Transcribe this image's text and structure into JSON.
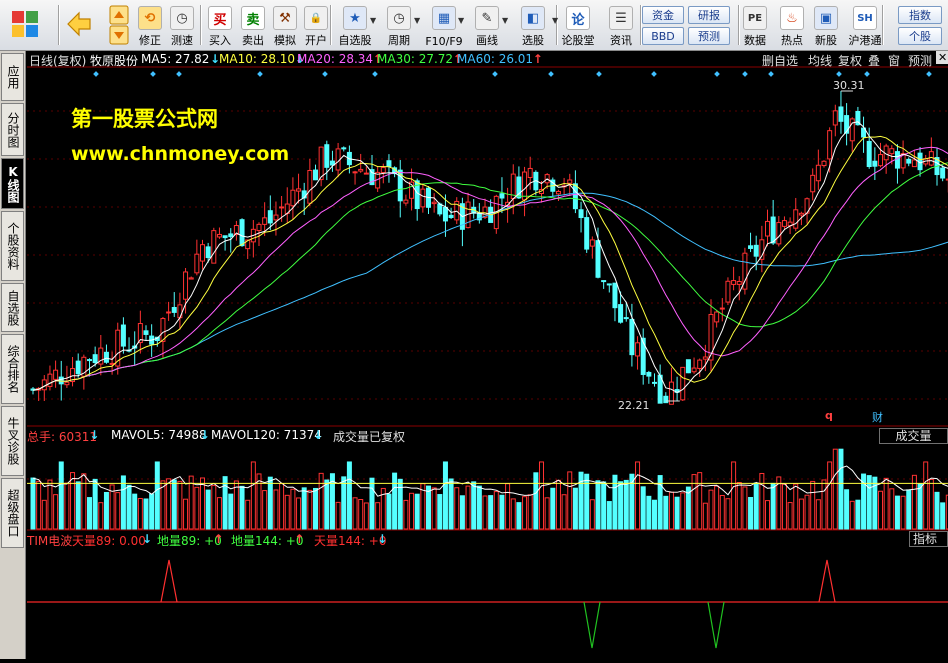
{
  "toolbar": {
    "buttons": [
      {
        "label": "",
        "icon": "app-grid-icon"
      },
      {
        "label": "",
        "icon": "back-arrow-icon"
      },
      {
        "label": "",
        "icon": "up-down-arrows-icon"
      },
      {
        "label": "修正",
        "icon": "adjust-icon"
      },
      {
        "label": "测速",
        "icon": "clock-icon"
      },
      {
        "label": "买入",
        "icon": "buy-icon",
        "glyph": "买"
      },
      {
        "label": "卖出",
        "icon": "sell-icon",
        "glyph": "卖"
      },
      {
        "label": "模拟",
        "icon": "hammer-icon"
      },
      {
        "label": "开户",
        "icon": "lock-icon"
      },
      {
        "label": "自选股",
        "icon": "star-icon"
      },
      {
        "label": "周期",
        "icon": "period-icon"
      },
      {
        "label": "F10/F9",
        "icon": "f10-icon"
      },
      {
        "label": "画线",
        "icon": "pen-icon"
      },
      {
        "label": "选股",
        "icon": "select-stock-icon"
      },
      {
        "label": "论股堂",
        "icon": "forum-icon",
        "glyph": "论"
      },
      {
        "label": "资讯",
        "icon": "news-icon"
      },
      {
        "label": "数据",
        "icon": "pe-icon",
        "glyph": "PE"
      },
      {
        "label": "热点",
        "icon": "hot-icon"
      },
      {
        "label": "新股",
        "icon": "new-stock-icon"
      },
      {
        "label": "沪港通",
        "icon": "hk-connect-icon",
        "glyph": "SSE HKE"
      }
    ],
    "pills": [
      "资金",
      "研报",
      "BBD",
      "预测",
      "指数",
      "个股"
    ]
  },
  "left_tabs": [
    "应用",
    "分时图",
    "K线图",
    "个股资料",
    "自选股",
    "综合排名",
    "牛叉诊股",
    "超级盘口"
  ],
  "active_tab": "K线图",
  "header": {
    "period": "日线(复权)",
    "stock_name": "牧原股份",
    "mas": [
      {
        "label": "MA5: 27.82",
        "arrow": "↓",
        "color": "#ffffff"
      },
      {
        "label": "MA10: 28.10",
        "arrow": "↓",
        "color": "#ffff40"
      },
      {
        "label": "MA20: 28.34",
        "arrow": "↑",
        "color": "#ff60ff"
      },
      {
        "label": "MA30: 27.72",
        "arrow": "↑",
        "color": "#40ff40"
      },
      {
        "label": "MA60: 26.01",
        "arrow": "↑",
        "color": "#40c0ff"
      }
    ],
    "right_buttons": [
      "删自选",
      "均线",
      "复权",
      "叠",
      "窗",
      "预测"
    ]
  },
  "watermark": {
    "line1": "第一股票公式网",
    "line2": "www.chnmoney.com"
  },
  "price_labels": {
    "high": "30.31",
    "low": "22.21"
  },
  "markers": {
    "q": "q",
    "cai": "财"
  },
  "volume_panel": {
    "label_total": "总手: 60311",
    "label_mavol5": "MAVOL5: 74988",
    "label_mavol120": "MAVOL120: 71374",
    "note": "成交量已复权",
    "right_button": "成交量"
  },
  "indicator_panel": {
    "name": "TIM电波",
    "items": [
      {
        "label": "天量89: 0.00",
        "arrow": "↓",
        "color": "#ff3030"
      },
      {
        "label": "地量89: +0",
        "arrow": "↑",
        "color": "#40ff40"
      },
      {
        "label": "地量144: +0",
        "arrow": "↑",
        "color": "#40ff40"
      },
      {
        "label": "天量144: +0",
        "arrow": "↓",
        "color": "#ff3030"
      }
    ],
    "right_button": "指标说"
  },
  "colors": {
    "up": "#ff3232",
    "down": "#54ffff",
    "ma5": "#ffffff",
    "ma10": "#ffff40",
    "ma20": "#ff60ff",
    "ma30": "#40ff40",
    "ma60": "#40c0ff",
    "watermark": "#ffff00"
  },
  "chart_data": {
    "type": "candlestick",
    "price_high": 30.31,
    "price_low": 22.21,
    "mas_latest": {
      "MA5": 27.82,
      "MA10": 28.1,
      "MA20": 28.34,
      "MA30": 27.72,
      "MA60": 26.01
    },
    "volume_latest": 60311,
    "mavol5": 74988,
    "mavol120": 71374
  }
}
